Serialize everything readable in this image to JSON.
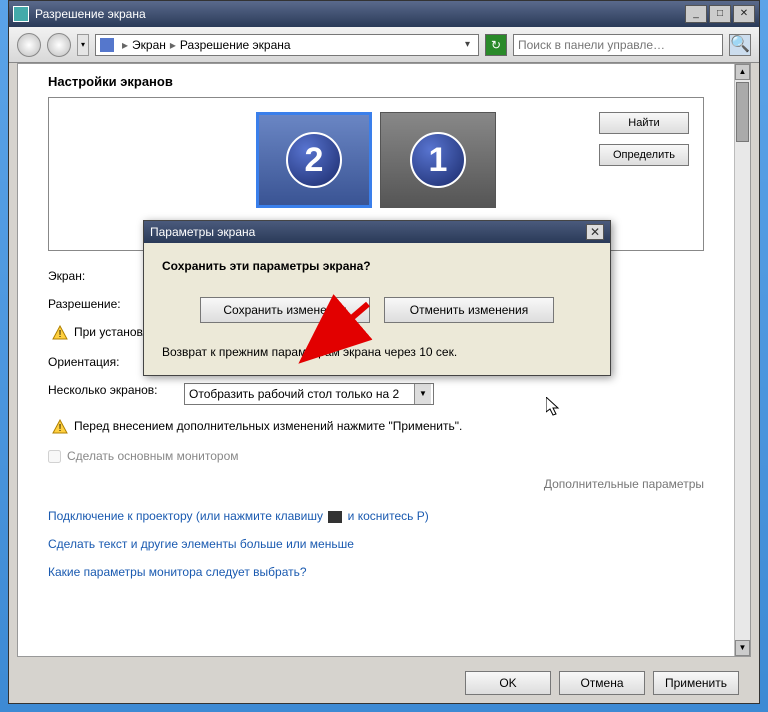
{
  "window": {
    "title": "Разрешение экрана",
    "breadcrumb": {
      "item1": "Экран",
      "item2": "Разрешение экрана"
    },
    "search_placeholder": "Поиск в панели управле…"
  },
  "section_title": "Настройки экранов",
  "monitor_buttons": {
    "find": "Найти",
    "identify": "Определить"
  },
  "monitors": {
    "mon1": "1",
    "mon2": "2"
  },
  "labels": {
    "screen": "Экран:",
    "resolution": "Разрешение:",
    "orientation": "Ориентация:",
    "multi": "Несколько экранов:"
  },
  "warnings": {
    "resolution_fit": "При установленном разрешении изображение может не полностью помещаться на экран.",
    "apply_first": "Перед внесением дополнительных изменений нажмите \"Применить\"."
  },
  "multi_value": "Отобразить рабочий стол только на 2",
  "main_monitor_checkbox": "Сделать основным монитором",
  "extended_params": "Дополнительные параметры",
  "links": {
    "projector_pre": "Подключение к проектору (или нажмите клавишу",
    "projector_post": "и коснитесь P)",
    "text_size": "Сделать текст и другие элементы больше или меньше",
    "which_monitor": "Какие параметры монитора следует выбрать?"
  },
  "footer": {
    "ok": "OK",
    "cancel": "Отмена",
    "apply": "Применить"
  },
  "modal": {
    "title": "Параметры экрана",
    "question": "Сохранить эти параметры экрана?",
    "save": "Сохранить изменения",
    "revert": "Отменить изменения",
    "countdown": "Возврат к прежним параметрам экрана через 10 сек."
  }
}
